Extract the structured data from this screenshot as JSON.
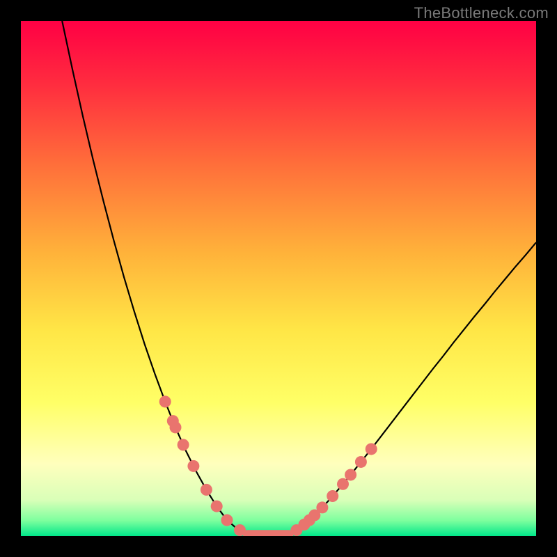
{
  "attribution": "TheBottleneck.com",
  "colors": {
    "page_bg": "#000000",
    "gradient_stops": [
      {
        "offset": "0%",
        "color": "#ff0044"
      },
      {
        "offset": "12%",
        "color": "#ff2b3f"
      },
      {
        "offset": "28%",
        "color": "#ff6f3a"
      },
      {
        "offset": "45%",
        "color": "#ffb23a"
      },
      {
        "offset": "60%",
        "color": "#ffe646"
      },
      {
        "offset": "74%",
        "color": "#ffff66"
      },
      {
        "offset": "86%",
        "color": "#ffffbd"
      },
      {
        "offset": "93%",
        "color": "#d9ffb8"
      },
      {
        "offset": "97%",
        "color": "#7dff9e"
      },
      {
        "offset": "100%",
        "color": "#00e78a"
      }
    ],
    "curve_stroke": "#000000",
    "marker_fill": "#e9746e",
    "flat_stroke": "#e9746e"
  },
  "chart_data": {
    "type": "line",
    "title": "",
    "xlabel": "",
    "ylabel": "",
    "xlim": [
      0,
      100
    ],
    "ylim": [
      0,
      100
    ],
    "grid": false,
    "legend": false,
    "series": [
      {
        "name": "left_branch",
        "x": [
          8,
          10,
          12,
          14,
          16,
          18,
          20,
          22,
          24,
          26,
          28,
          30,
          32,
          34,
          36,
          38,
          40,
          42,
          44
        ],
        "y": [
          100,
          90.6,
          81.6,
          73.1,
          65.1,
          57.5,
          50.3,
          43.6,
          37.3,
          31.5,
          26.1,
          21.1,
          16.6,
          12.6,
          9.0,
          5.8,
          3.1,
          1.4,
          0.4
        ]
      },
      {
        "name": "flat_segment",
        "x": [
          44,
          46,
          48,
          50,
          52
        ],
        "y": [
          0.4,
          0.1,
          0.0,
          0.1,
          0.4
        ]
      },
      {
        "name": "right_branch",
        "x": [
          52,
          54,
          56,
          58,
          60,
          62,
          64,
          66,
          68,
          70,
          72,
          74,
          76,
          78,
          80,
          82,
          84,
          86,
          88,
          90,
          92,
          94,
          96,
          98,
          100
        ],
        "y": [
          0.4,
          1.4,
          3.1,
          5.0,
          7.2,
          9.5,
          11.9,
          14.4,
          16.9,
          19.5,
          22.1,
          24.7,
          27.3,
          29.9,
          32.5,
          35.0,
          37.6,
          40.1,
          42.6,
          45.0,
          47.5,
          49.9,
          52.3,
          54.6,
          57.0
        ]
      }
    ],
    "markers": {
      "left": {
        "x": [
          28,
          29.5,
          30,
          31.5,
          33.5,
          36,
          38,
          40,
          42.5
        ],
        "y_from_curve": "left_branch"
      },
      "right": {
        "x": [
          53.5,
          55,
          56,
          57,
          58.5,
          60.5,
          62.5,
          64,
          66,
          68
        ],
        "y_from_curve": "right_branch"
      },
      "radius": 8.5
    },
    "flat_highlight": {
      "x_start": 44,
      "x_end": 52,
      "y": 0.3
    }
  }
}
